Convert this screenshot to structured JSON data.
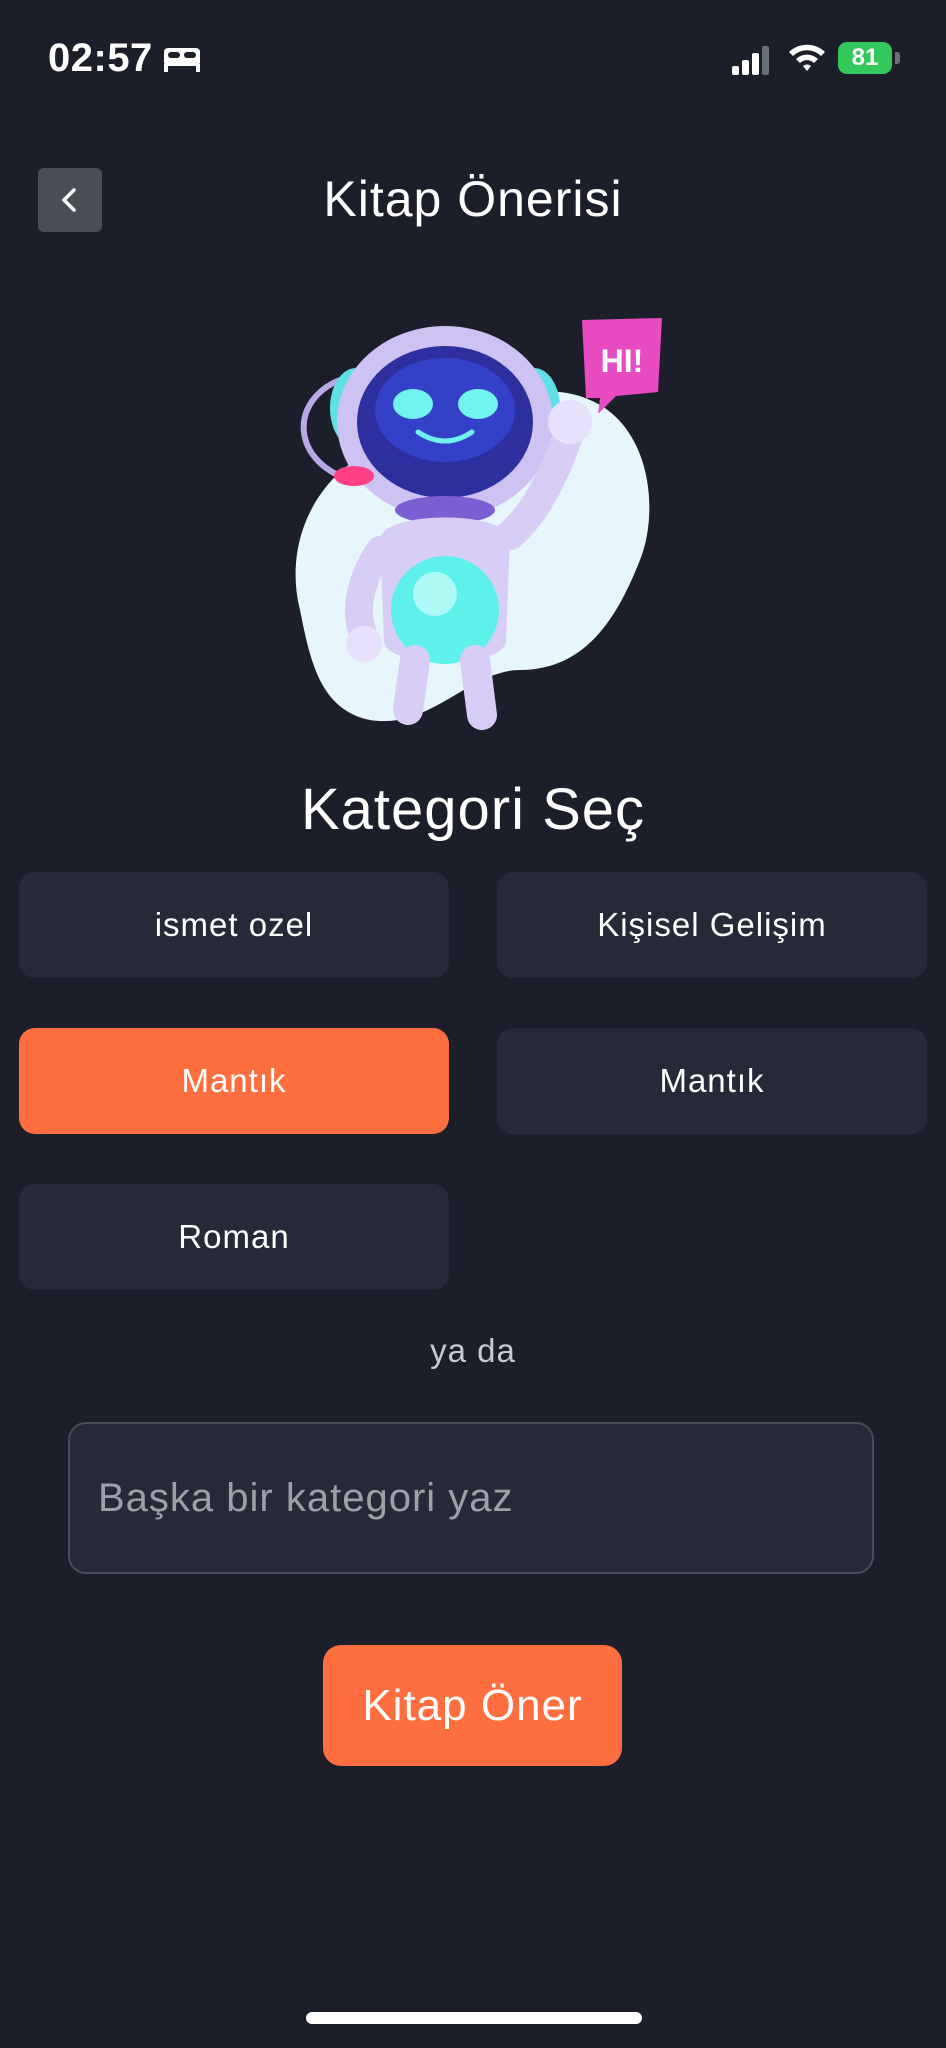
{
  "status_bar": {
    "time": "02:57",
    "battery_level": "81",
    "icons": [
      "sleep-icon",
      "signal-icon",
      "wifi-icon",
      "battery-icon"
    ]
  },
  "header": {
    "title": "Kitap Önerisi",
    "back_icon": "chevron-left-icon"
  },
  "mascot": {
    "icon": "robot-mascot-illustration",
    "speech_bubble_text": "HI!"
  },
  "main": {
    "section_title": "Kategori Seç",
    "categories": [
      {
        "label": "ismet ozel",
        "selected": false
      },
      {
        "label": "Kişisel Gelişim",
        "selected": false
      },
      {
        "label": "Mantık",
        "selected": true
      },
      {
        "label": "Mantık",
        "selected": false
      },
      {
        "label": "Roman",
        "selected": false
      }
    ],
    "or_text": "ya da",
    "custom_category": {
      "value": "",
      "placeholder": "Başka bir kategori yaz"
    },
    "submit_label": "Kitap Öner"
  },
  "colors": {
    "background": "#1c1f2a",
    "card": "#262937",
    "accent": "#ff6e3f",
    "battery": "#34c759"
  }
}
